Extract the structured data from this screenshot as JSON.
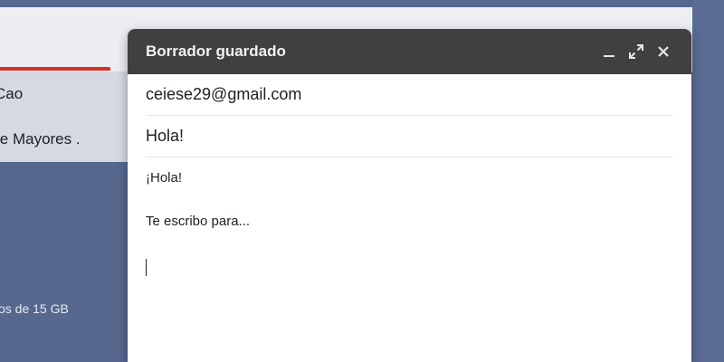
{
  "background": {
    "rows": [
      {
        "label": "Cao"
      },
      {
        "label": "le Mayores ."
      }
    ],
    "storage_text": "os de 15 GB",
    "accent_color": "#d93025"
  },
  "compose": {
    "title": "Borrador guardado",
    "buttons": {
      "minimize": "minimize-icon",
      "expand": "expand-icon",
      "close": "close-icon"
    },
    "to_value": "ceiese29@gmail.com",
    "subject_value": "Hola!",
    "body_lines": [
      "¡Hola!",
      "Te escribo para..."
    ],
    "header_color": "#404040"
  }
}
